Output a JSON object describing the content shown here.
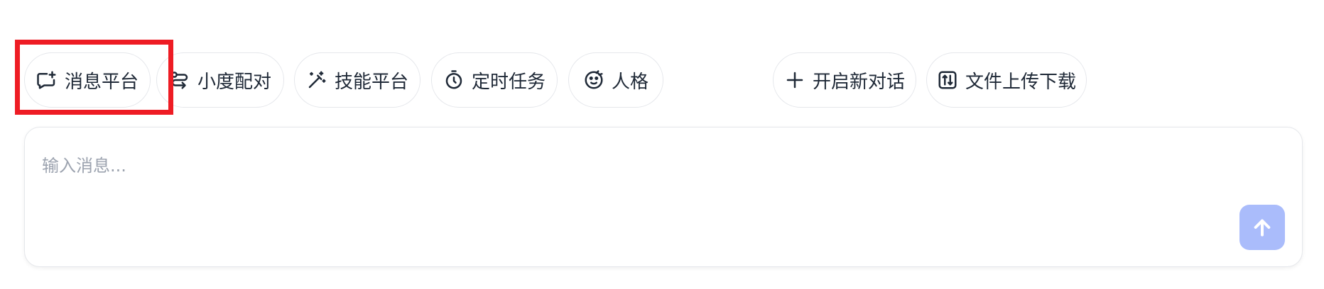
{
  "toolbar": {
    "chips": [
      {
        "label": "消息平台",
        "icon": "message-plus-icon"
      },
      {
        "label": "小度配对",
        "icon": "route-icon"
      },
      {
        "label": "技能平台",
        "icon": "magic-wand-icon"
      },
      {
        "label": "定时任务",
        "icon": "timer-icon"
      },
      {
        "label": "人格",
        "icon": "persona-face-icon"
      }
    ],
    "new_chat_label": "开启新对话",
    "file_transfer_label": "文件上传下载"
  },
  "composer": {
    "placeholder": "输入消息...",
    "send_icon": "arrow-up-icon"
  },
  "colors": {
    "highlight": "#ee1c24",
    "send_button": "#aabcfb",
    "link": "#4f46e5"
  }
}
